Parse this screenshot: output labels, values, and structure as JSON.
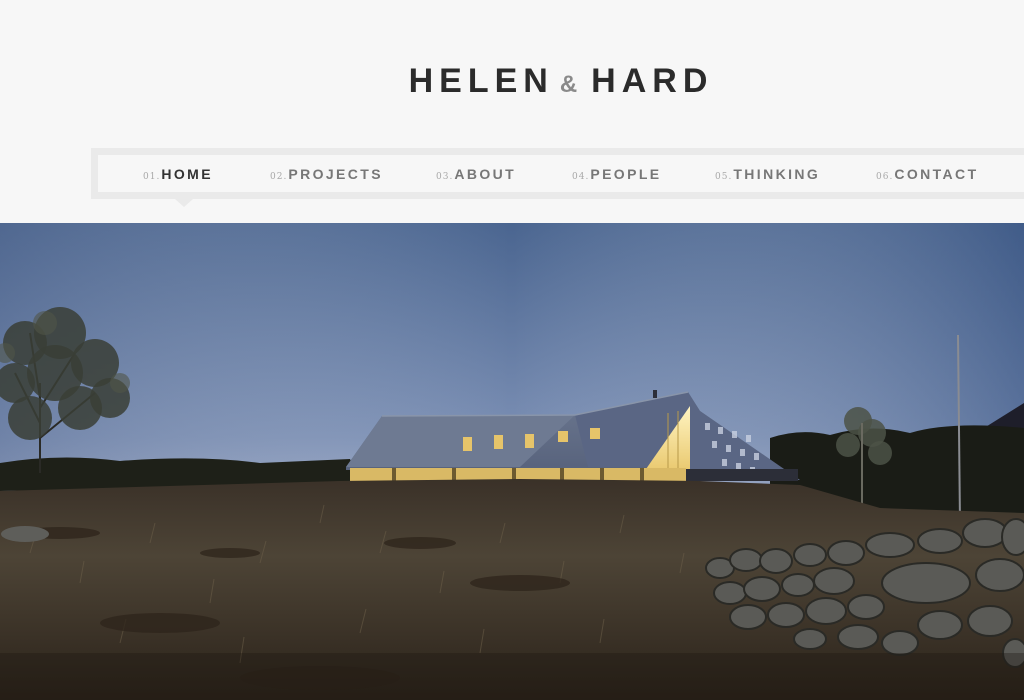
{
  "logo": {
    "first": "HELEN",
    "amp": "&",
    "second": "HARD"
  },
  "nav": {
    "items": [
      {
        "num": "01.",
        "label": "HOME",
        "active": true
      },
      {
        "num": "02.",
        "label": "PROJECTS",
        "active": false
      },
      {
        "num": "03.",
        "label": "ABOUT",
        "active": false
      },
      {
        "num": "04.",
        "label": "PEOPLE",
        "active": false
      },
      {
        "num": "05.",
        "label": "THINKING",
        "active": false
      },
      {
        "num": "06.",
        "label": "CONTACT",
        "active": false
      }
    ]
  },
  "colors": {
    "background": "#f7f7f7",
    "nav_frame": "#eaeaea",
    "logo_text": "#2b2b2b",
    "nav_active": "#333333",
    "nav_text": "#777777"
  }
}
